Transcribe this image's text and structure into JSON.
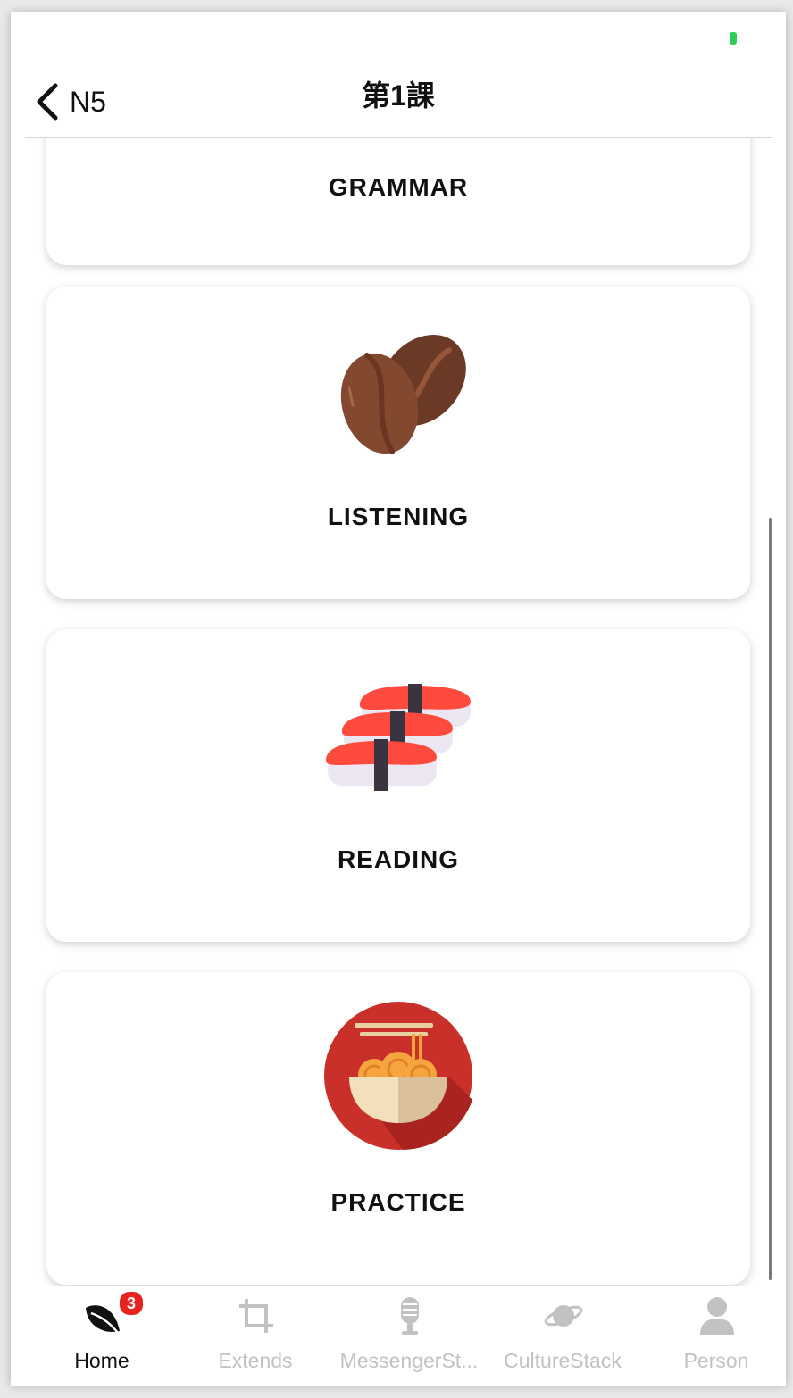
{
  "header": {
    "back_label": "N5",
    "title": "第1課"
  },
  "lessons": [
    {
      "label": "GRAMMAR",
      "icon": "grammar-icon"
    },
    {
      "label": "LISTENING",
      "icon": "coffee-beans-icon"
    },
    {
      "label": "READING",
      "icon": "sushi-icon"
    },
    {
      "label": "PRACTICE",
      "icon": "noodle-bowl-icon"
    }
  ],
  "tabbar": {
    "items": [
      {
        "label": "Home",
        "icon": "leaf-icon",
        "active": true,
        "badge": "3"
      },
      {
        "label": "Extends",
        "icon": "crop-icon",
        "active": false
      },
      {
        "label": "MessengerSt...",
        "icon": "microphone-icon",
        "active": false
      },
      {
        "label": "CultureStack",
        "icon": "planet-icon",
        "active": false
      },
      {
        "label": "Person",
        "icon": "person-icon",
        "active": false
      }
    ]
  },
  "colors": {
    "status_indicator": "#2fcd58",
    "badge": "#e8231f",
    "tab_inactive": "#c2c2c2",
    "tab_active": "#111111"
  }
}
